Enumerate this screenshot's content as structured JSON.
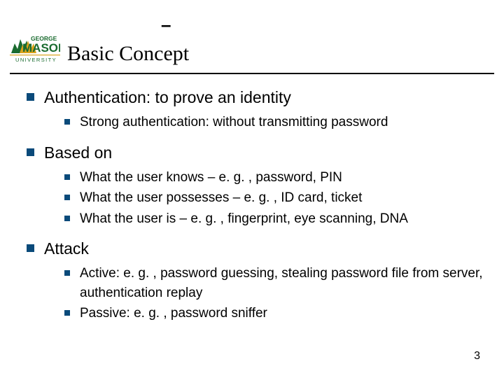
{
  "top_dash": "–",
  "title": "Basic Concept",
  "logo": {
    "text_top": "GEORGE",
    "text_bottom": "MASON",
    "sub": "UNIVERSITY"
  },
  "sections": [
    {
      "heading": "Authentication: to prove an identity",
      "items": [
        "Strong authentication: without transmitting password"
      ]
    },
    {
      "heading": "Based on",
      "items": [
        "What the user knows – e. g. , password, PIN",
        "What the user possesses – e. g. , ID card, ticket",
        "What the user is – e. g. , fingerprint, eye scanning, DNA"
      ]
    },
    {
      "heading": "Attack",
      "items": [
        "Active: e. g. , password guessing, stealing password file from server, authentication replay",
        "Passive: e. g. , password sniffer"
      ]
    }
  ],
  "page_number": "3",
  "colors": {
    "bullet": "#0a4a7a",
    "logo_green": "#1a6b2f",
    "logo_gold": "#d9a21b"
  }
}
